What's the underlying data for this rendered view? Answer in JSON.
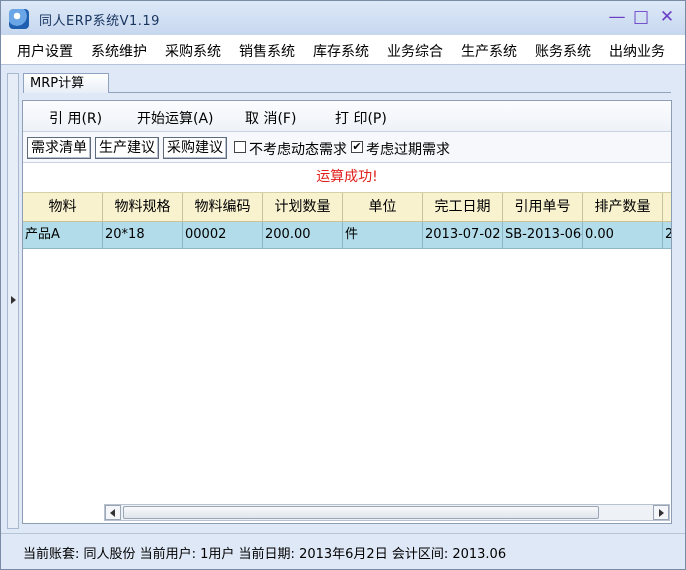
{
  "window": {
    "title": "同人ERP系统V1.19",
    "icon": "app-logo-icon"
  },
  "menu": [
    "用户设置",
    "系统维护",
    "采购系统",
    "销售系统",
    "库存系统",
    "业务综合",
    "生产系统",
    "账务系统",
    "出纳业务"
  ],
  "tab": {
    "label": "MRP计算"
  },
  "toolbar": {
    "quote": "引 用(R)",
    "start": "开始运算(A)",
    "cancel": "取 消(F)",
    "print": "打 印(P)"
  },
  "options": {
    "demand_list": "需求清单",
    "production_suggest": "生产建议",
    "purchase_suggest": "采购建议",
    "ignore_dynamic": {
      "label": "不考虑动态需求",
      "checked": false
    },
    "consider_overdue": {
      "label": "考虑过期需求",
      "checked": true
    }
  },
  "status_message": "运算成功!",
  "grid": {
    "headers": [
      "物料",
      "物料规格",
      "物料编码",
      "计划数量",
      "单位",
      "完工日期",
      "引用单号",
      "排产数量",
      ""
    ],
    "rows": [
      [
        "产品A",
        "20*18",
        "00002",
        "200.00",
        "件",
        "2013-07-02",
        "SB-2013-06-",
        "0.00",
        "2"
      ]
    ]
  },
  "statusbar": {
    "text": "当前账套: 同人股份  当前用户: 1用户  当前日期: 2013年6月2日  会计区间: 2013.06"
  }
}
